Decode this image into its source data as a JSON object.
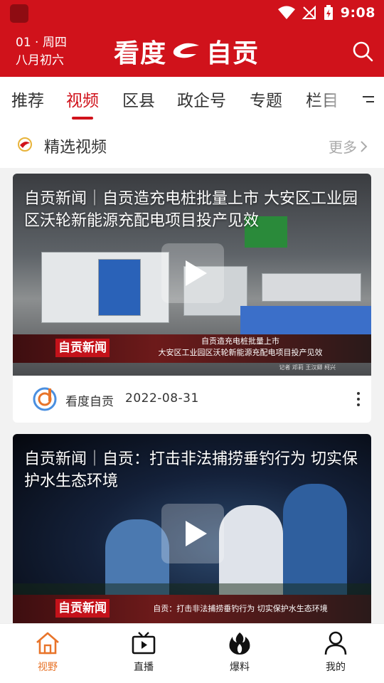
{
  "colors": {
    "brand_red": "#d0121b",
    "active_orange": "#e8742a",
    "text_dark": "#333333",
    "muted": "#aaaaaa"
  },
  "status_bar": {
    "time": "9:08",
    "icons": [
      "wifi-icon",
      "signal-off-icon",
      "battery-charging-icon"
    ]
  },
  "header": {
    "date_line1": "01 · 周四",
    "date_line2": "八月初六",
    "logo_left": "看度",
    "logo_right": "自贡",
    "search_icon": "search-icon"
  },
  "tabs": [
    {
      "label": "推荐",
      "active": false
    },
    {
      "label": "视频",
      "active": true
    },
    {
      "label": "区县",
      "active": false
    },
    {
      "label": "政企号",
      "active": false
    },
    {
      "label": "专题",
      "active": false
    },
    {
      "label": "栏目",
      "active": false
    }
  ],
  "section": {
    "title": "精选视频",
    "more_label": "更多"
  },
  "videos": [
    {
      "title": "自贡新闻｜自贡造充电桩批量上市  大安区工业园区沃轮新能源充配电项目投产见效",
      "brand": "自贡新闻",
      "caption_line1": "自贡造充电桩批量上市",
      "caption_line2": "大安区工业园区沃轮新能源充配电项目投产见效",
      "reporter": "记者 邓莉 王汉卿 柯兴",
      "source": "看度自贡",
      "date": "2022-08-31"
    },
    {
      "title": "自贡新闻｜自贡：打击非法捕捞垂钓行为  切实保护水生态环境",
      "brand": "自贡新闻",
      "caption_line1": "自贡：打击非法捕捞垂钓行为 切实保护水生态环境"
    }
  ],
  "bottom_nav": [
    {
      "label": "视野",
      "icon": "home-icon",
      "active": true
    },
    {
      "label": "直播",
      "icon": "tv-play-icon",
      "active": false
    },
    {
      "label": "爆料",
      "icon": "flame-icon",
      "active": false
    },
    {
      "label": "我的",
      "icon": "user-icon",
      "active": false
    }
  ]
}
